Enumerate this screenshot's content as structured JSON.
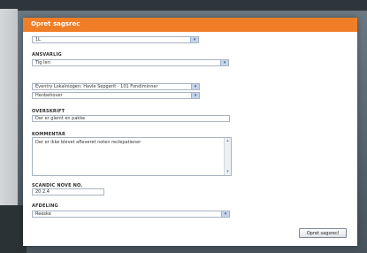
{
  "header": {
    "title": "Opret sagsrec"
  },
  "form": {
    "top_select": "1L",
    "ansvarlig": {
      "label": "ANSVARLIG",
      "value": "Tig leri"
    },
    "queue_select": "Eventry Lokalniogen: Havle Sepgerit - 101 Fondiminner",
    "type_select": "Henbehover",
    "overskrift": {
      "label": "OVERSKRIFT",
      "value": "Der er glemt en pakke"
    },
    "kommentar": {
      "label": "KOMMENTAR",
      "value": "Der er ikke blevet afleveret noten reclepatiener"
    },
    "scandic": {
      "label": "SCANDIC NOVE NO.",
      "value": "20 2.4"
    },
    "afdeling": {
      "label": "AFDELING",
      "value": "Reeske"
    },
    "submit": "Opret sagsrecl"
  },
  "icons": {
    "select_arrow": "chevron-down-icon",
    "scroll_up": "chevron-up-icon",
    "scroll_down": "chevron-down-icon"
  },
  "colors": {
    "header": "#f07e26",
    "border": "#a8b4c2",
    "arrow_bg": "#c7d5ea"
  }
}
